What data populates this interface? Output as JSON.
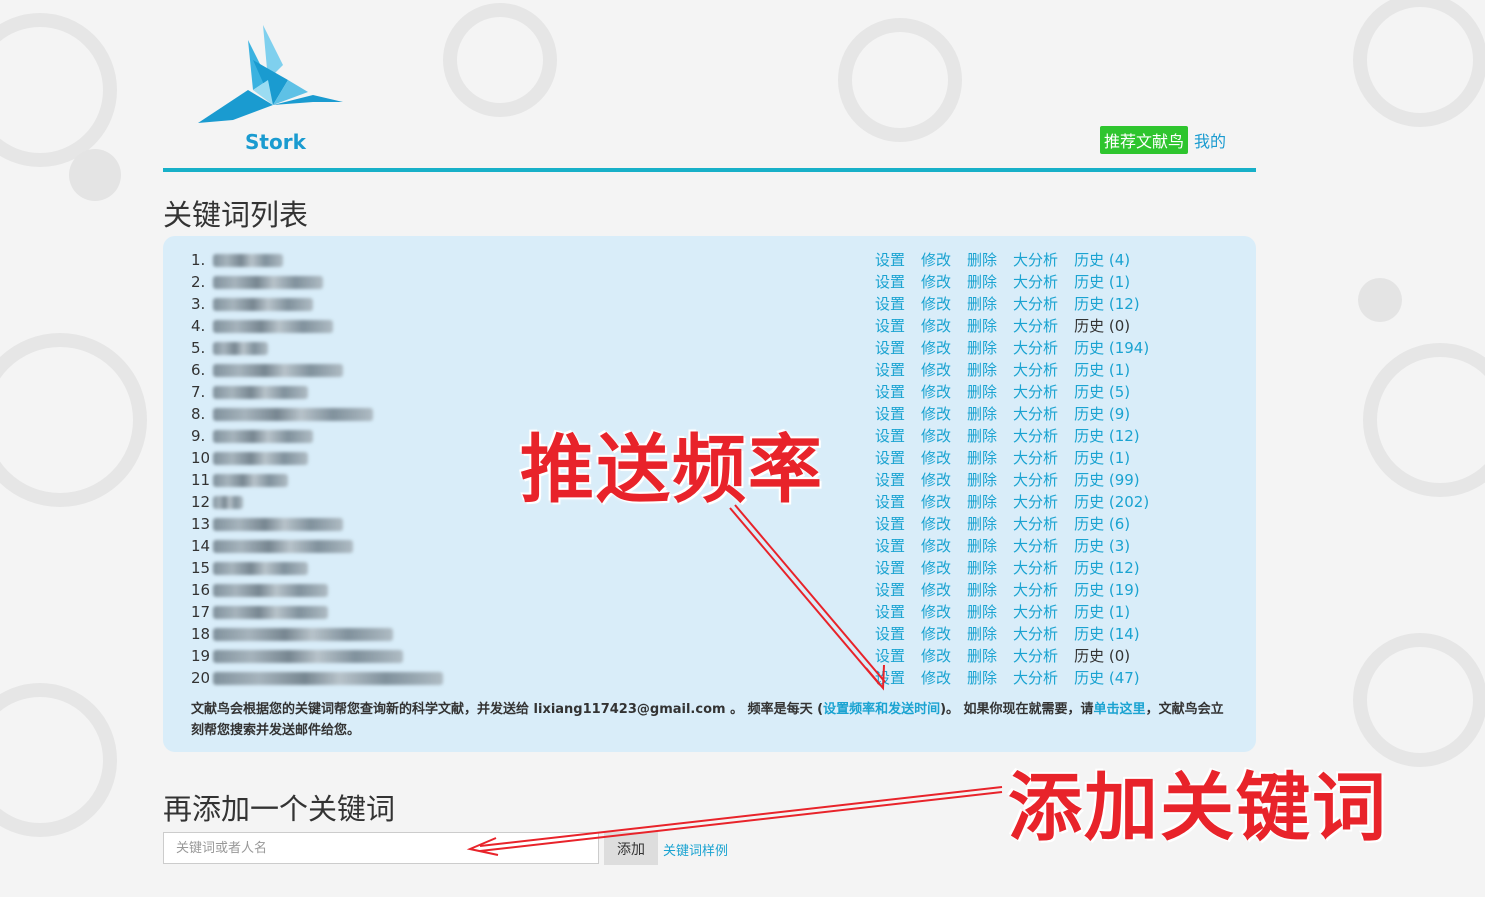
{
  "brand": {
    "name": "Stork"
  },
  "nav": {
    "push_label": "推荐文献鸟",
    "mine_label": "我的"
  },
  "keyword_list": {
    "heading": "关键词列表",
    "actions": {
      "settings": "设置",
      "edit": "修改",
      "delete": "删除",
      "analysis": "大分析",
      "history": "历史"
    },
    "items": [
      {
        "num": "1.",
        "history_count": "(4)"
      },
      {
        "num": "2.",
        "history_count": "(1)"
      },
      {
        "num": "3.",
        "history_count": "(12)"
      },
      {
        "num": "4.",
        "history_count": "(0)"
      },
      {
        "num": "5.",
        "history_count": "(194)"
      },
      {
        "num": "6.",
        "history_count": "(1)"
      },
      {
        "num": "7.",
        "history_count": "(5)"
      },
      {
        "num": "8.",
        "history_count": "(9)"
      },
      {
        "num": "9.",
        "history_count": "(12)"
      },
      {
        "num": "10",
        "history_count": "(1)"
      },
      {
        "num": "11",
        "history_count": "(99)"
      },
      {
        "num": "12",
        "history_count": "(202)"
      },
      {
        "num": "13",
        "history_count": "(6)"
      },
      {
        "num": "14",
        "history_count": "(3)"
      },
      {
        "num": "15",
        "history_count": "(12)"
      },
      {
        "num": "16",
        "history_count": "(19)"
      },
      {
        "num": "17",
        "history_count": "(1)"
      },
      {
        "num": "18",
        "history_count": "(14)"
      },
      {
        "num": "19",
        "history_count": "(0)"
      },
      {
        "num": "20",
        "history_count": "(47)"
      }
    ],
    "notice": {
      "part1": "文献鸟会根据您的关键词帮您查询新的科学文献，并发送给 lixiang117423@gmail.com 。 频率是每天 (",
      "link1": "设置频率和发送时间",
      "part2": ")。 如果你现在就需要，请",
      "link2": "单击这里",
      "part3": "，文献鸟会立刻帮您搜索并发送邮件给您。"
    }
  },
  "add_keyword": {
    "heading": "再添加一个关键词",
    "placeholder": "关键词或者人名",
    "button_label": "添加",
    "examples_link": "关键词样例"
  },
  "annotations": {
    "push_frequency": "推送频率",
    "add_keyword": "添加关键词"
  },
  "colors": {
    "accent": "#1aa3d1",
    "divider": "#17b0c8",
    "panel": "#d9edf9",
    "push_button": "#2ec52e",
    "annotation": "#e8232a"
  }
}
